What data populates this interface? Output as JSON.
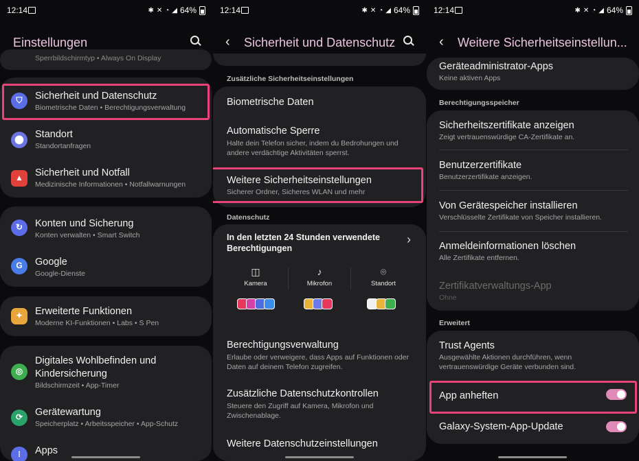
{
  "status": {
    "time": "12:14",
    "battery": "64%"
  },
  "panel1": {
    "title": "Einstellungen",
    "top_partial": "Sperrbildschirmtyp  •  Always On Display",
    "items": [
      {
        "title": "Sicherheit und Datenschutz",
        "subtitle": "Biometrische Daten  •  Berechtigungsverwaltung",
        "icon": "shield-icon",
        "color": "#5b6ee8"
      },
      {
        "title": "Standort",
        "subtitle": "Standortanfragen",
        "icon": "location-pin-icon",
        "color": "#6b74e0"
      },
      {
        "title": "Sicherheit und Notfall",
        "subtitle": "Medizinische Informationen  •  Notfallwarnungen",
        "icon": "emergency-icon",
        "color": "#e0413b"
      },
      {
        "title": "Konten und Sicherung",
        "subtitle": "Konten verwalten  •  Smart Switch",
        "icon": "sync-icon",
        "color": "#5b6ee8"
      },
      {
        "title": "Google",
        "subtitle": "Google-Dienste",
        "icon": "google-icon",
        "color": "#4a7ce8"
      },
      {
        "title": "Erweiterte Funktionen",
        "subtitle": "Moderne KI-Funktionen  •  Labs  •  S Pen",
        "icon": "star-gear-icon",
        "color": "#e8a53b"
      },
      {
        "title": "Digitales Wohlbefinden und",
        "title2": "Kindersicherung",
        "subtitle": "Bildschirmzeit  •  App-Timer",
        "icon": "wellbeing-icon",
        "color": "#3fae4f"
      },
      {
        "title": "Gerätewartung",
        "subtitle": "Speicherplatz  •  Arbeitsspeicher  •  App-Schutz",
        "icon": "device-care-icon",
        "color": "#2aa36b"
      },
      {
        "title": "Apps",
        "icon": "apps-icon",
        "color": "#5b6ee8"
      }
    ]
  },
  "panel2": {
    "title": "Sicherheit und Datenschutz",
    "section1": "Zusätzliche Sicherheitseinstellungen",
    "items1": [
      {
        "title": "Biometrische Daten"
      },
      {
        "title": "Automatische Sperre",
        "subtitle": "Halte dein Telefon sicher, indem du Bedrohungen und",
        "subtitle2": "andere verdächtige Aktivitäten sperrst."
      },
      {
        "title": "Weitere Sicherheitseinstellungen",
        "subtitle": "Sicherer Ordner, Sicheres WLAN und mehr"
      }
    ],
    "section2": "Datenschutz",
    "recent": {
      "title": "In den letzten 24 Stunden verwendete",
      "title2": "Berechtigungen"
    },
    "perms": [
      {
        "label": "Kamera",
        "icon": "camera-icon"
      },
      {
        "label": "Mikrofon",
        "icon": "microphone-icon"
      },
      {
        "label": "Standort",
        "icon": "location-pin-icon"
      }
    ],
    "items2": [
      {
        "title": "Berechtigungsverwaltung",
        "subtitle": "Erlaube oder verweigere, dass Apps auf Funktionen oder",
        "subtitle2": "Daten auf deinem Telefon zugreifen."
      },
      {
        "title": "Zusätzliche Datenschutzkontrollen",
        "subtitle": "Steuere den Zugriff auf Kamera, Mikrofon und",
        "subtitle2": "Zwischenablage."
      },
      {
        "title": "Weitere Datenschutzeinstellungen"
      }
    ]
  },
  "panel3": {
    "title": "Weitere Sicherheitseinstellun...",
    "top_item": {
      "title": "Geräteadministrator-Apps",
      "subtitle": "Keine aktiven Apps"
    },
    "section1": "Berechtigungsspeicher",
    "items1": [
      {
        "title": "Sicherheitszertifikate anzeigen",
        "subtitle": "Zeigt vertrauenswürdige CA-Zertifikate an."
      },
      {
        "title": "Benutzerzertifikate",
        "subtitle": "Benutzerzertifikate anzeigen."
      },
      {
        "title": "Von Gerätespeicher installieren",
        "subtitle": "Verschlüsselte Zertifikate von Speicher installieren."
      },
      {
        "title": "Anmeldeinformationen löschen",
        "subtitle": "Alle Zertifikate entfernen."
      },
      {
        "title": "Zertifikatverwaltungs-App",
        "subtitle": "Ohne"
      }
    ],
    "section2": "Erweitert",
    "items2": [
      {
        "title": "Trust Agents",
        "subtitle": "Ausgewählte Aktionen durchführen, wenn",
        "subtitle2": "vertrauenswürdige Geräte verbunden sind."
      },
      {
        "title": "App anheften",
        "toggle": true
      },
      {
        "title": "Galaxy-System-App-Update",
        "toggle": true
      }
    ]
  },
  "colors": {
    "highlight": "#e8437a",
    "title": "#ecc4df",
    "card": "#212124",
    "toggle": "#e08ab7"
  }
}
